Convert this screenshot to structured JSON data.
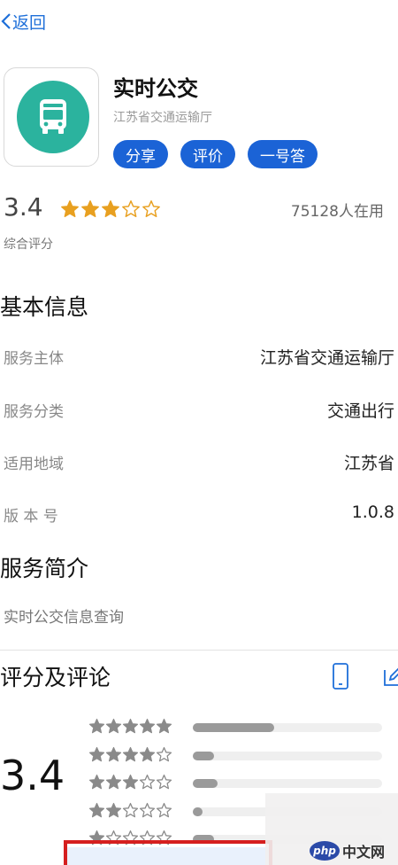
{
  "nav": {
    "back_label": "返回"
  },
  "app": {
    "name": "实时公交",
    "developer": "江苏省交通运输厅",
    "actions": [
      "分享",
      "评价",
      "一号答"
    ],
    "icon": "bus-icon",
    "accent_color": "#2bb39e",
    "button_color": "#1b63d6"
  },
  "rating": {
    "score": "3.4",
    "stars_filled": 3,
    "stars_total": 5,
    "users": "75128人在用",
    "caption": "综合评分"
  },
  "basic_info": {
    "title": "基本信息",
    "rows": [
      {
        "label": "服务主体",
        "value": "江苏省交通运输厅"
      },
      {
        "label": "服务分类",
        "value": "交通出行"
      },
      {
        "label": "适用地域",
        "value": "江苏省"
      },
      {
        "label": "版 本 号",
        "value": "1.0.8"
      }
    ]
  },
  "intro": {
    "title": "服务简介",
    "text": "实时公交信息查询"
  },
  "reviews": {
    "title": "评分及评论",
    "big_score": "3.4",
    "distribution": [
      {
        "stars": 5,
        "fraction": 0.43
      },
      {
        "stars": 4,
        "fraction": 0.11
      },
      {
        "stars": 3,
        "fraction": 0.13
      },
      {
        "stars": 2,
        "fraction": 0.05
      },
      {
        "stars": 1,
        "fraction": 0.11
      }
    ],
    "icons": [
      "phone-icon",
      "edit-icon"
    ]
  },
  "watermark": {
    "logo_text": "php",
    "site_text": "中文网"
  }
}
